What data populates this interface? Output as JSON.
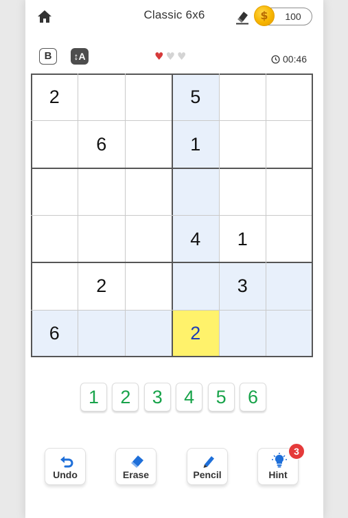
{
  "header": {
    "home_icon": "home-icon",
    "title": "Classic 6x6",
    "eraser_icon": "eraser-icon",
    "coin_icon": "coin-icon",
    "coin_symbol": "$",
    "coins": "100"
  },
  "status": {
    "mode_b_label": "B",
    "mode_a_label": "↕A",
    "lives_total": 3,
    "lives_remaining": 1,
    "heart_full_color": "#d63a3a",
    "heart_empty_color": "#d4d4d4",
    "heart_glyph": "♥",
    "timer": "00:46"
  },
  "board": {
    "size": 6,
    "box_rows": 2,
    "box_cols": 3,
    "cells": [
      [
        "2",
        "",
        "",
        "5",
        "",
        ""
      ],
      [
        "",
        "6",
        "",
        "1",
        "",
        ""
      ],
      [
        "",
        "",
        "",
        "",
        "",
        ""
      ],
      [
        "",
        "",
        "",
        "4",
        "1",
        ""
      ],
      [
        "",
        "2",
        "",
        "",
        "3",
        ""
      ],
      [
        "6",
        "",
        "",
        "2",
        "",
        ""
      ]
    ],
    "selected": {
      "row": 5,
      "col": 3
    },
    "highlight_color": "#e8f0fb",
    "selected_color": "#fff26b",
    "entered_digit_color": "#1d3cb5"
  },
  "numpad": {
    "digits": [
      "1",
      "2",
      "3",
      "4",
      "5",
      "6"
    ],
    "color": "#18a34a"
  },
  "toolbar": {
    "undo_label": "Undo",
    "erase_label": "Erase",
    "pencil_label": "Pencil",
    "hint_label": "Hint",
    "hint_count": "3",
    "accent_color": "#1e6fd9"
  }
}
